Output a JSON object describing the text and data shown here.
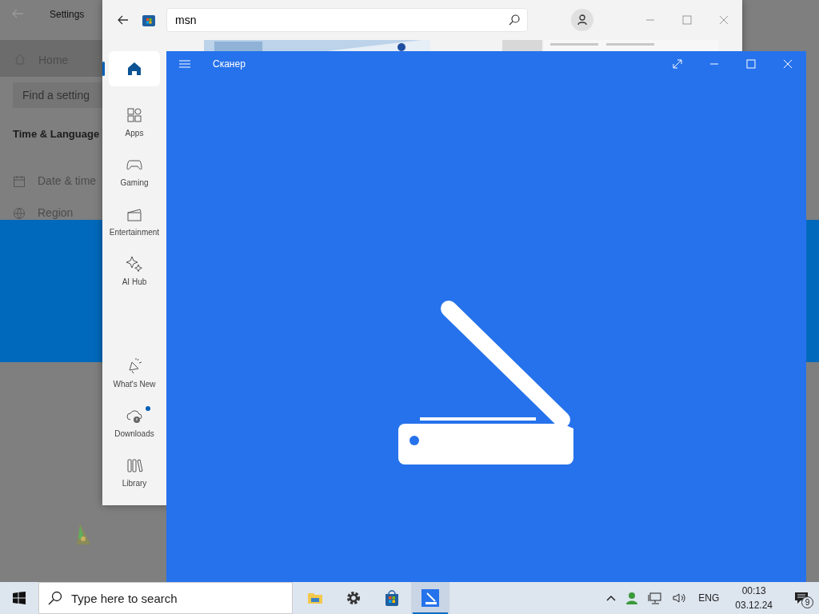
{
  "settings": {
    "title": "Settings",
    "home": "Home",
    "search": {
      "placeholder": "Find a setting"
    },
    "section": "Time & Language",
    "items": [
      {
        "label": "Date & time",
        "kind": "calendar"
      },
      {
        "label": "Region",
        "kind": "globe"
      }
    ]
  },
  "store": {
    "search": {
      "value": "msn"
    },
    "nav": [
      {
        "kind": "home",
        "selected": true,
        "notification": false
      },
      {
        "label": "Apps",
        "kind": "apps",
        "selected": false,
        "notification": false
      },
      {
        "label": "Gaming",
        "kind": "gaming",
        "selected": false,
        "notification": false
      },
      {
        "label": "Entertainment",
        "kind": "entertainment",
        "selected": false,
        "notification": false
      },
      {
        "label": "AI Hub",
        "kind": "ai",
        "selected": false,
        "notification": false
      }
    ],
    "bottom_nav": [
      {
        "label": "What's New",
        "kind": "news",
        "selected": false,
        "notification": false
      },
      {
        "label": "Downloads",
        "kind": "downloads",
        "selected": false,
        "notification": true
      },
      {
        "label": "Library",
        "kind": "library",
        "selected": false,
        "notification": false
      }
    ]
  },
  "scanner": {
    "title": "Сканер"
  },
  "taskbar": {
    "search": {
      "placeholder": "Type here to search"
    },
    "apps": [
      {
        "kind": "folder",
        "active": false
      },
      {
        "kind": "gear",
        "active": false
      },
      {
        "kind": "store",
        "active": false
      },
      {
        "kind": "scanner",
        "active": true
      }
    ],
    "language": "ENG",
    "time": "00:13",
    "date": "03.12.24",
    "notification_count": "9"
  }
}
